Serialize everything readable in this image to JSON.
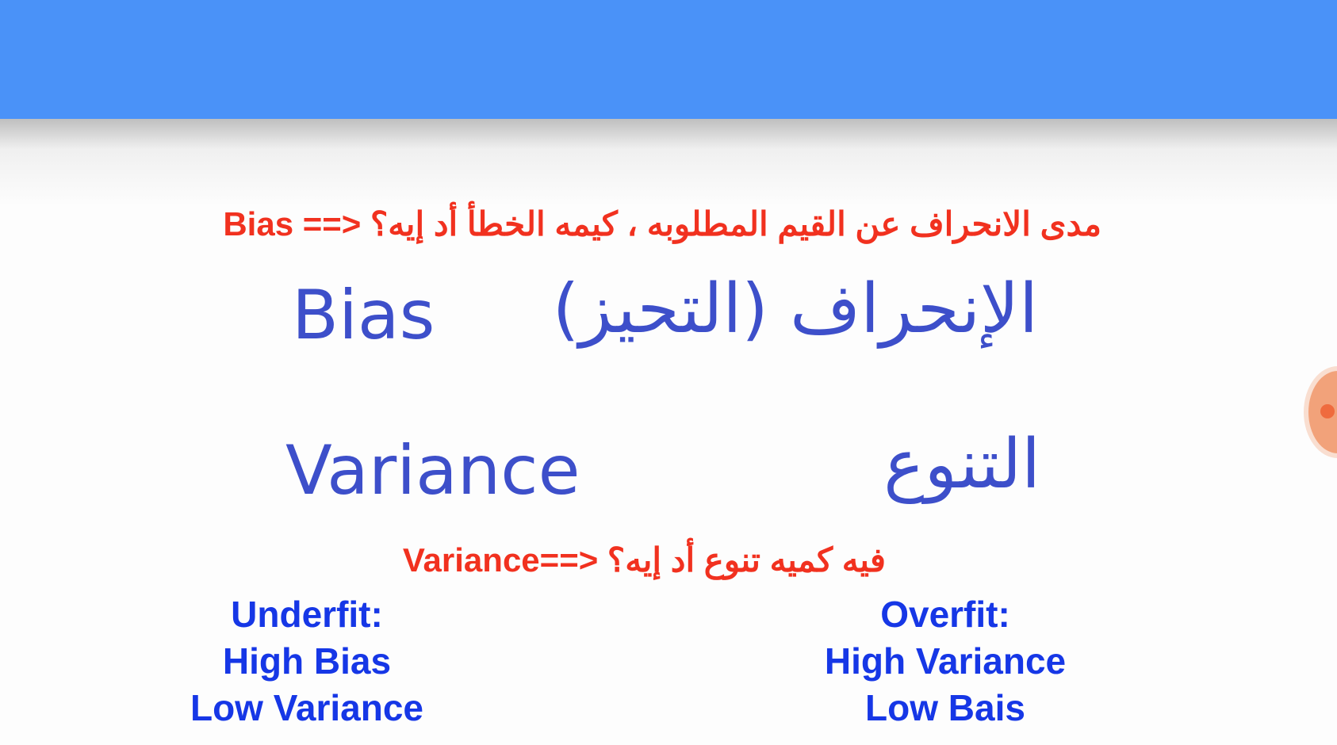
{
  "colors": {
    "top_bar": "#4a92f8",
    "annotation": "#f1311f",
    "slide_text": "#3d4fca",
    "summary_text": "#1637e6",
    "handle": "#f2a27a"
  },
  "annotations": {
    "bias": "مدى الانحراف عن القيم المطلوبه ، كيمه الخطأ أد إيه؟ <== Bias",
    "variance": "فيه كميه تنوع أد إيه؟ <==Variance"
  },
  "slide": {
    "bias_en": "Bias",
    "bias_ar": "الإنحراف (التحيز)",
    "variance_en": "Variance",
    "variance_ar": "التنوع"
  },
  "underfit": {
    "title": "Underfit:",
    "line1": "High Bias",
    "line2": "Low Variance"
  },
  "overfit": {
    "title": "Overfit:",
    "line1": "High Variance",
    "line2": "Low Bais"
  },
  "icons": {
    "side_handle": "circle-handle-icon"
  }
}
